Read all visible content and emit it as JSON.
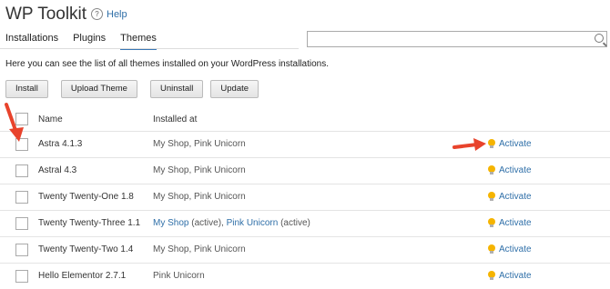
{
  "app": {
    "title": "WP Toolkit",
    "help_label": "Help"
  },
  "tabs": [
    {
      "label": "Installations",
      "active": false
    },
    {
      "label": "Plugins",
      "active": false
    },
    {
      "label": "Themes",
      "active": true
    }
  ],
  "search": {
    "value": "",
    "placeholder": ""
  },
  "intro_text": "Here you can see the list of all themes installed on your WordPress installations.",
  "toolbar": {
    "install": "Install",
    "upload": "Upload Theme",
    "uninstall": "Uninstall",
    "update": "Update"
  },
  "table": {
    "headers": {
      "name": "Name",
      "installed_at": "Installed at"
    },
    "rows": [
      {
        "name": "Astra 4.1.3",
        "installed_at": "My Shop, Pink Unicorn",
        "action": "Activate"
      },
      {
        "name": "Astral 4.3",
        "installed_at": "My Shop, Pink Unicorn",
        "action": "Activate"
      },
      {
        "name": "Twenty Twenty-One 1.8",
        "installed_at": "My Shop, Pink Unicorn",
        "action": "Activate"
      },
      {
        "name": "Twenty Twenty-Three 1.1",
        "installed_at_parts": {
          "site1": "My Shop",
          "sep1": " (active), ",
          "site2": "Pink Unicorn",
          "sep2": " (active)"
        },
        "action": "Activate"
      },
      {
        "name": "Twenty Twenty-Two 1.4",
        "installed_at": "My Shop, Pink Unicorn",
        "action": "Activate"
      },
      {
        "name": "Hello Elementor 2.7.1",
        "installed_at": "Pink Unicorn",
        "action": "Activate"
      }
    ]
  },
  "colors": {
    "link": "#2f6fa8",
    "arrow": "#e8432c",
    "bulb": "#f5b400"
  }
}
